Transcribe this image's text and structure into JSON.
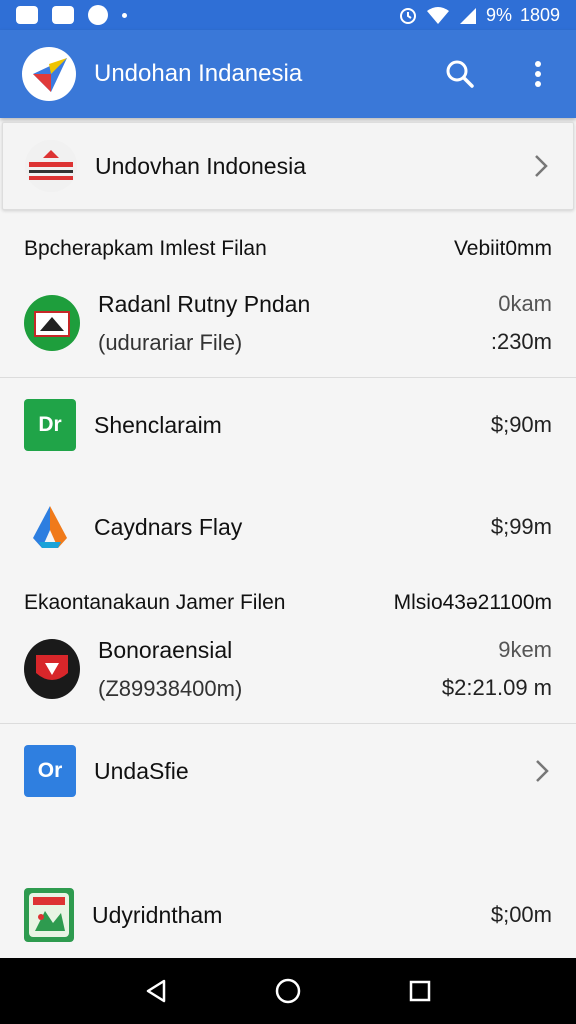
{
  "status_bar": {
    "battery": "9%",
    "time": "1809"
  },
  "app_bar": {
    "title": "Undohan Indanesia"
  },
  "header_card": {
    "title": "Undovhan Indonesia"
  },
  "sections": [
    {
      "left": "Bpcherapkam Imlest Filan",
      "right": "Vebiit0mm"
    },
    {
      "left": "Ekaontanakaun Jamer Filen",
      "right": "Mlsio43ə21100m"
    }
  ],
  "items": [
    {
      "icon": "flag-badge-icon",
      "icon_color": "#1e9e3c",
      "primary": "Radanl Rutny Pndan",
      "secondary": "(udurariar File)",
      "meta_top": "0kam",
      "meta_bottom": ":230m"
    },
    {
      "icon_label": "Dr",
      "icon_color": "#20a448",
      "primary": "Shenclaraim",
      "meta": "$;90m"
    },
    {
      "icon": "drive-triangle-icon",
      "primary": "Caydnars Flay",
      "meta": "$;99m"
    },
    {
      "icon": "shield-red-icon",
      "primary": "Bonoraensial",
      "secondary": "(Z89938400m)",
      "meta_top": "9kem",
      "meta_bottom": "$2:21.09 m"
    },
    {
      "icon_label": "Or",
      "icon_color": "#2f7fe0",
      "primary": "UndaSfie"
    },
    {
      "icon": "map-app-icon",
      "primary": "Udyridntham",
      "meta": "$;00m"
    }
  ]
}
